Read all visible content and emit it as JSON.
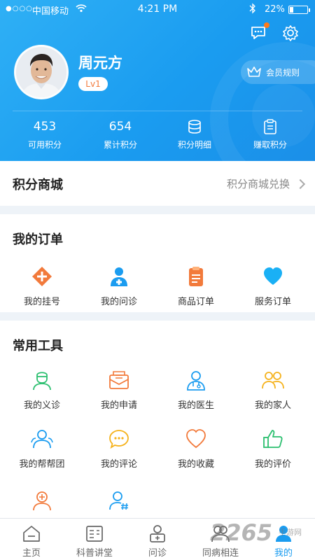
{
  "status_bar": {
    "signal": "●○○○",
    "carrier": "中国移动",
    "time": "4:21 PM",
    "battery": "22%",
    "battery_level": 0.22
  },
  "profile": {
    "name": "周元方",
    "level": "Lv1",
    "member_rules": "会员规则"
  },
  "stats": [
    {
      "value": "453",
      "label": "可用积分"
    },
    {
      "value": "654",
      "label": "累计积分"
    },
    {
      "icon": "database-icon",
      "label": "积分明细"
    },
    {
      "icon": "clipboard-icon",
      "label": "赚取积分"
    }
  ],
  "mall": {
    "title": "积分商城",
    "link": "积分商城兑换"
  },
  "orders": {
    "title": "我的订单",
    "items": [
      {
        "label": "我的挂号",
        "icon": "plus-circle-icon",
        "color": "#f27a3b"
      },
      {
        "label": "我的问诊",
        "icon": "doctor-icon",
        "color": "#1a9cf0"
      },
      {
        "label": "商品订单",
        "icon": "order-icon",
        "color": "#f27a3b"
      },
      {
        "label": "服务订单",
        "icon": "heart-icon",
        "color": "#1a9cf0"
      }
    ]
  },
  "tools": {
    "title": "常用工具",
    "items": [
      {
        "label": "我的义诊",
        "icon": "nurse-icon",
        "color": "#2bbf6f"
      },
      {
        "label": "我的申请",
        "icon": "mail-icon",
        "color": "#f27a3b"
      },
      {
        "label": "我的医生",
        "icon": "doctor-outline-icon",
        "color": "#1a9cf0"
      },
      {
        "label": "我的家人",
        "icon": "family-icon",
        "color": "#f5b21c"
      },
      {
        "label": "我的帮帮团",
        "icon": "group-icon",
        "color": "#1a9cf0"
      },
      {
        "label": "我的评论",
        "icon": "comment-icon",
        "color": "#f5b21c"
      },
      {
        "label": "我的收藏",
        "icon": "favorite-heart-icon",
        "color": "#f27a3b"
      },
      {
        "label": "我的评价",
        "icon": "thumbs-up-icon",
        "color": "#2bbf6f"
      },
      {
        "label": "",
        "icon": "person-plus-icon",
        "color": "#f27a3b"
      },
      {
        "label": "",
        "icon": "person-hash-icon",
        "color": "#1a9cf0"
      }
    ]
  },
  "tabbar": [
    {
      "label": "主页",
      "icon": "home-icon"
    },
    {
      "label": "科普讲堂",
      "icon": "lecture-icon"
    },
    {
      "label": "问诊",
      "icon": "consult-icon"
    },
    {
      "label": "同病相连",
      "icon": "community-icon"
    },
    {
      "label": "我的",
      "icon": "profile-icon",
      "active": true
    }
  ],
  "watermark": {
    "text": "2265",
    "sub": "手游网"
  }
}
